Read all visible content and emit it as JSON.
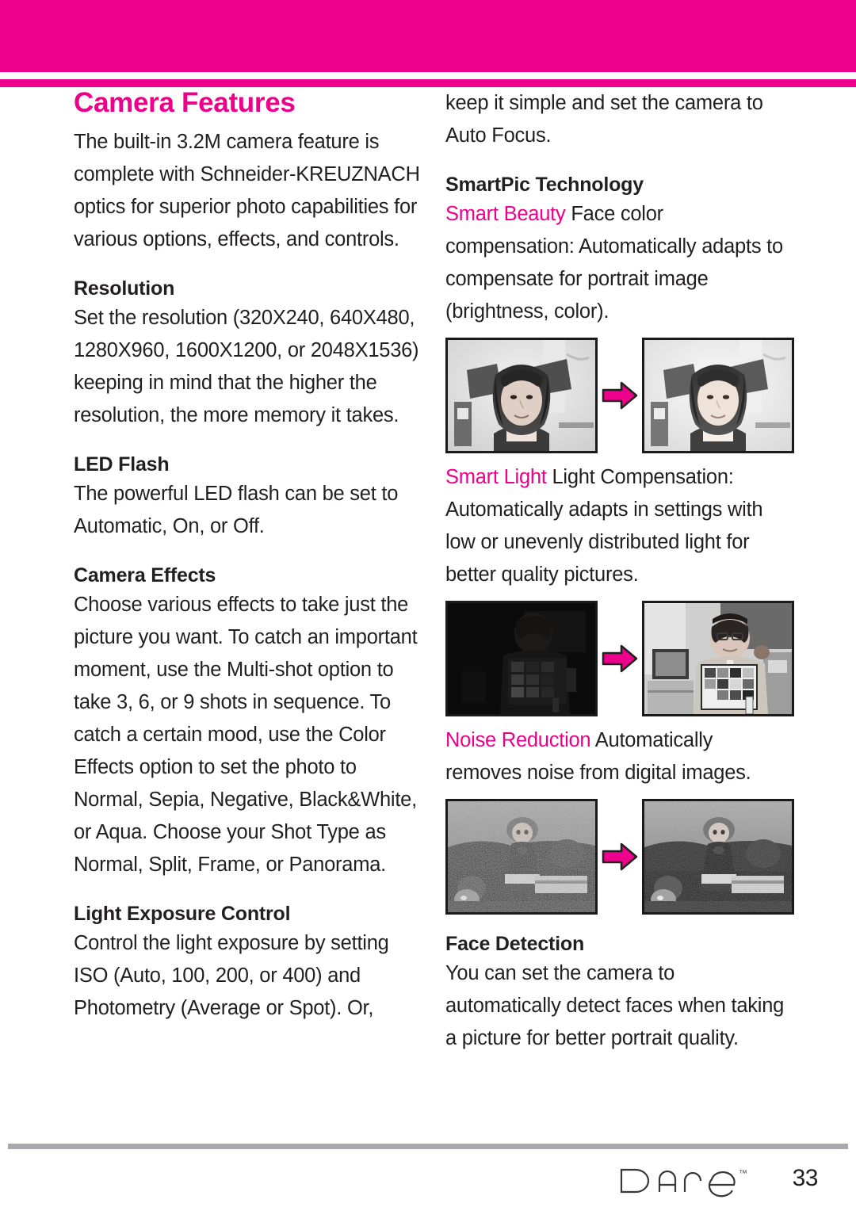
{
  "header": {
    "band_color": "#ec008c",
    "rule_color": "#ec008c"
  },
  "page_title": "Camera Features",
  "left_column": {
    "intro": "The built-in 3.2M camera feature is complete with Schneider-KREUZNACH optics for superior photo capabilities for various options, effects, and controls.",
    "sections": [
      {
        "heading": "Resolution",
        "body": "Set the resolution (320X240, 640X480, 1280X960, 1600X1200, or 2048X1536) keeping in mind that the higher the resolution, the more memory it takes."
      },
      {
        "heading": "LED Flash",
        "body": "The powerful LED flash can be set to Automatic, On, or Off."
      },
      {
        "heading": "Camera Effects",
        "body": "Choose various effects to take just the picture you want. To catch an important moment, use the Multi-shot option to take 3, 6, or 9 shots in sequence. To catch a certain mood, use the Color Effects option to set the photo to Normal, Sepia, Negative, Black&White, or Aqua. Choose your Shot Type as Normal, Split, Frame, or Panorama."
      },
      {
        "heading": "Light Exposure Control",
        "body": "Control the light exposure by setting ISO (Auto, 100, 200, or 400) and Photometry (Average or Spot). Or,"
      }
    ]
  },
  "right_column": {
    "continuation": "keep it simple and set the camera to Auto Focus.",
    "smartpic_heading": "SmartPic Technology",
    "features": [
      {
        "term": "Smart Beauty",
        "term_color": "#ec008c",
        "description": " Face color compensation: Automatically adapts to compensate for portrait image (brightness, color).",
        "figure": {
          "name": "smart-beauty-comparison",
          "before_alt": "portrait-photo-before",
          "after_alt": "portrait-photo-after",
          "arrow": "arrow-right-icon"
        }
      },
      {
        "term": "Smart Light",
        "term_color": "#ec008c",
        "description": " Light Compensation: Automatically adapts in settings with low or unevenly distributed light for better quality pictures.",
        "figure": {
          "name": "smart-light-comparison",
          "before_alt": "dark-photo-before",
          "after_alt": "lit-photo-after",
          "arrow": "arrow-right-icon"
        }
      },
      {
        "term": "Noise Reduction",
        "term_color": "#ec008c",
        "description": " Automatically removes noise from digital images.",
        "figure": {
          "name": "noise-reduction-comparison",
          "before_alt": "noisy-photo-before",
          "after_alt": "denoised-photo-after",
          "arrow": "arrow-right-icon"
        }
      }
    ],
    "face_detection": {
      "heading": "Face Detection",
      "body": "You can set the camera to automatically detect faces when taking a picture for better portrait quality."
    }
  },
  "footer": {
    "brand": "Dare",
    "trademark": "™",
    "page_number": "33",
    "rule_color": "#a7a9ac"
  }
}
